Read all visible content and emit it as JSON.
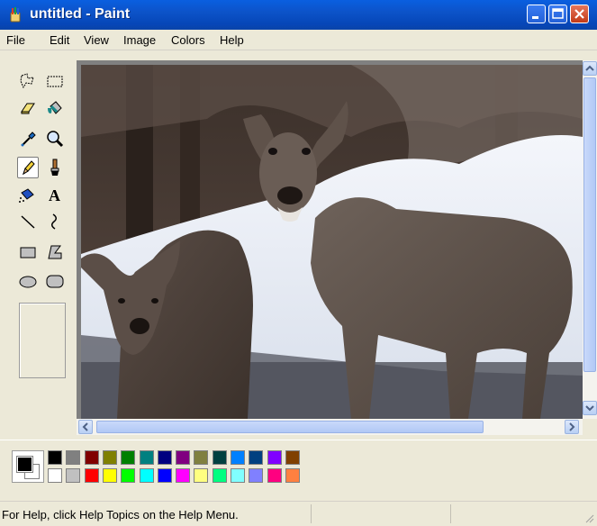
{
  "window": {
    "title": "untitled - Paint",
    "controls": [
      "minimize",
      "maximize",
      "close"
    ]
  },
  "menu": [
    "File",
    "Edit",
    "View",
    "Image",
    "Colors",
    "Help"
  ],
  "tools": [
    {
      "name": "free-form-select",
      "icon": "freeform-select-icon"
    },
    {
      "name": "select",
      "icon": "rect-select-icon"
    },
    {
      "name": "eraser",
      "icon": "eraser-icon"
    },
    {
      "name": "fill-with-color",
      "icon": "paint-bucket-icon"
    },
    {
      "name": "pick-color",
      "icon": "eyedropper-icon"
    },
    {
      "name": "magnifier",
      "icon": "magnifier-icon"
    },
    {
      "name": "pencil",
      "icon": "pencil-icon",
      "selected": true
    },
    {
      "name": "brush",
      "icon": "brush-icon"
    },
    {
      "name": "airbrush",
      "icon": "airbrush-icon"
    },
    {
      "name": "text",
      "icon": "text-icon"
    },
    {
      "name": "line",
      "icon": "line-icon"
    },
    {
      "name": "curve",
      "icon": "curve-icon"
    },
    {
      "name": "rectangle",
      "icon": "rectangle-icon"
    },
    {
      "name": "polygon",
      "icon": "polygon-icon"
    },
    {
      "name": "ellipse",
      "icon": "ellipse-icon"
    },
    {
      "name": "rounded-rectangle",
      "icon": "rounded-rect-icon"
    }
  ],
  "colors": {
    "foreground": "#000000",
    "background": "#ffffff",
    "palette_top": [
      "#000000",
      "#808080",
      "#800000",
      "#808000",
      "#008000",
      "#008080",
      "#000080",
      "#800080",
      "#808040",
      "#004040",
      "#0080ff",
      "#004080",
      "#8000ff",
      "#804000"
    ],
    "palette_bottom": [
      "#ffffff",
      "#c0c0c0",
      "#ff0000",
      "#ffff00",
      "#00ff00",
      "#00ffff",
      "#0000ff",
      "#ff00ff",
      "#ffff80",
      "#00ff80",
      "#80ffff",
      "#8080ff",
      "#ff0080",
      "#ff8040"
    ]
  },
  "canvas": {
    "image_subject": "two mule deer in snow"
  },
  "status": {
    "help_text": "For Help, click Help Topics on the Help Menu."
  }
}
